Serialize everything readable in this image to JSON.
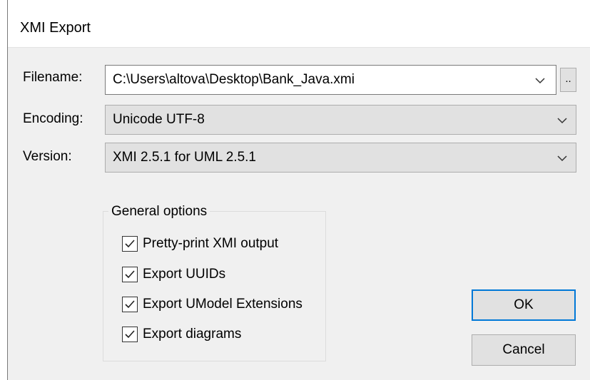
{
  "dialog": {
    "title": "XMI Export"
  },
  "form": {
    "filename_label": "Filename:",
    "filename_value": "C:\\Users\\altova\\Desktop\\Bank_Java.xmi",
    "browse_label": "..",
    "encoding_label": "Encoding:",
    "encoding_value": "Unicode UTF-8",
    "version_label": "Version:",
    "version_value": "XMI 2.5.1 for UML 2.5.1"
  },
  "options": {
    "group_title": "General options",
    "items": [
      {
        "label": "Pretty-print XMI output",
        "checked": true
      },
      {
        "label": "Export UUIDs",
        "checked": true
      },
      {
        "label": "Export UModel Extensions",
        "checked": true
      },
      {
        "label": "Export diagrams",
        "checked": true
      }
    ]
  },
  "buttons": {
    "ok_label": "OK",
    "cancel_label": "Cancel"
  },
  "colors": {
    "accent": "#0078d7",
    "dialog_bg": "#f0f0f0",
    "titlebar_bg": "#ffffff"
  },
  "icons": {
    "dropdown": "chevron-down-icon",
    "checkmark": "checkmark-icon"
  }
}
